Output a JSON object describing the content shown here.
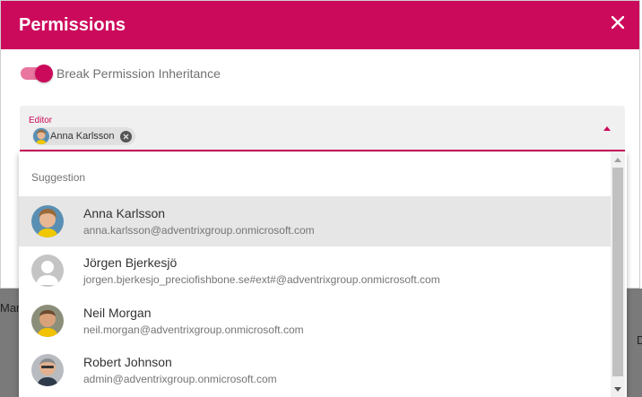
{
  "background": {
    "left_text": "Mar",
    "right_letter": "D"
  },
  "dialog": {
    "title": "Permissions",
    "close_icon": "close-icon",
    "toggle": {
      "label": "Break Permission Inheritance",
      "checked": true
    },
    "editor": {
      "label": "Editor",
      "chips": [
        {
          "label": "Anna Karlsson",
          "avatar": "avatar-anna"
        }
      ]
    }
  },
  "suggestions": {
    "header": "Suggestion",
    "items": [
      {
        "name": "Anna Karlsson",
        "email": "anna.karlsson@adventrixgroup.onmicrosoft.com",
        "avatar": "avatar-anna",
        "selected": true
      },
      {
        "name": "Jörgen Bjerkesjö",
        "email": "jorgen.bjerkesjo_preciofishbone.se#ext#@adventrixgroup.onmicrosoft.com",
        "avatar": "avatar-placeholder",
        "selected": false
      },
      {
        "name": "Neil Morgan",
        "email": "neil.morgan@adventrixgroup.onmicrosoft.com",
        "avatar": "avatar-neil",
        "selected": false
      },
      {
        "name": "Robert Johnson",
        "email": "admin@adventrixgroup.onmicrosoft.com",
        "avatar": "avatar-robert",
        "selected": false
      }
    ]
  },
  "colors": {
    "accent": "#cc0a5c",
    "accent_light": "#e8769f",
    "selected_row": "#e6e6e6"
  }
}
